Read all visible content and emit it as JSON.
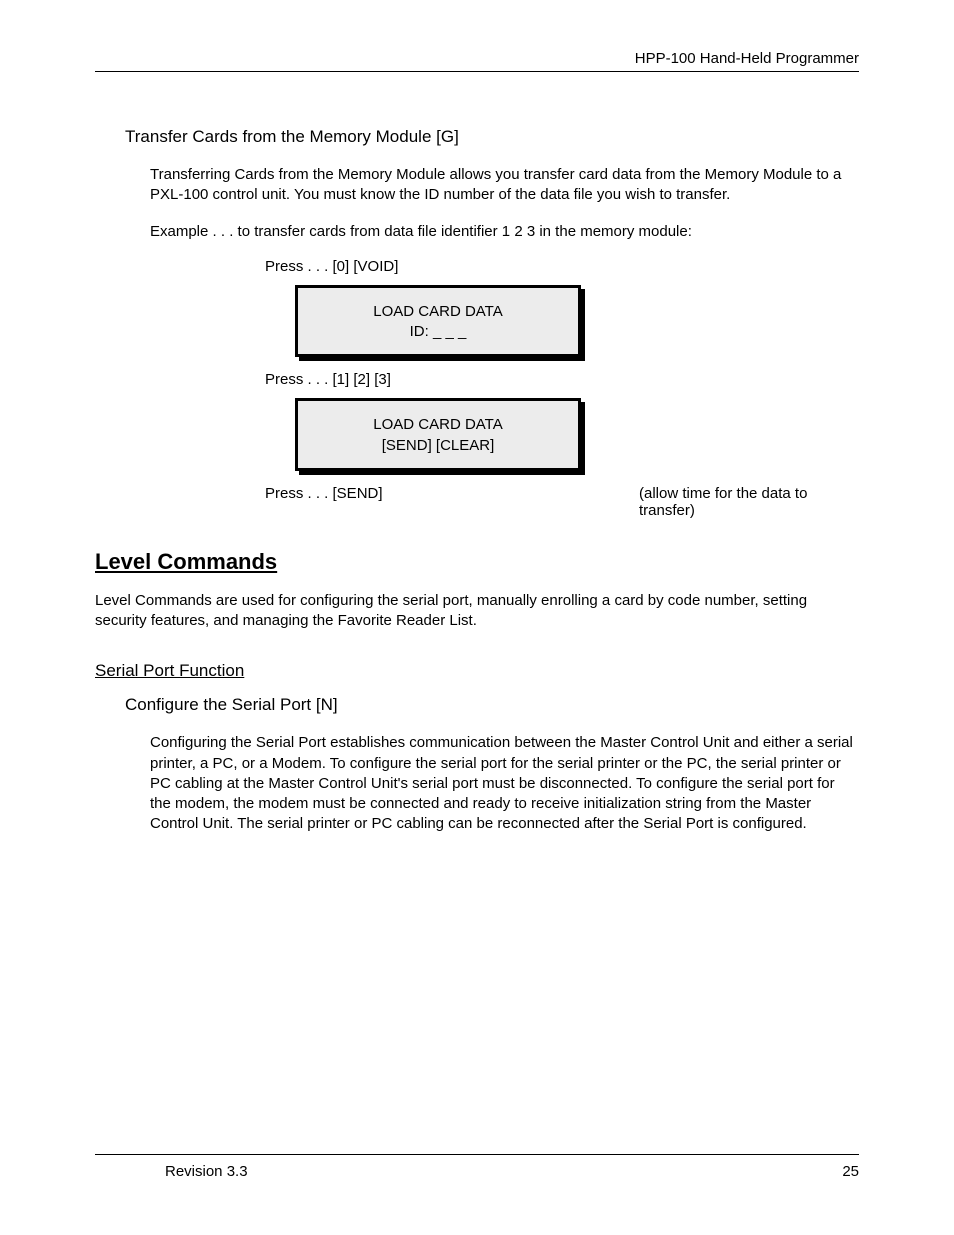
{
  "header": {
    "title": "HPP-100  Hand-Held Programmer"
  },
  "section1": {
    "title": "Transfer Cards from the Memory Module [G]",
    "para1": "Transferring Cards from the Memory Module allows you transfer card data from the Memory Module to a PXL-100 control unit. You must know the ID number of the data file you wish to transfer.",
    "para2": "Example . . . to transfer cards from data file identifier  1  2  3  in the memory module:",
    "press1": "Press . . . [0]     [VOID]",
    "lcd1_line1": "LOAD CARD DATA",
    "lcd1_line2": "ID:  _  _  _",
    "press2": "Press . . . [1]  [2]  [3]",
    "lcd2_line1": "LOAD CARD DATA",
    "lcd2_line2": "[SEND]     [CLEAR]",
    "press3_left": "Press . . . [SEND]",
    "press3_right": "(allow time for the data to transfer)"
  },
  "section2": {
    "h1": "Level Commands",
    "para1": "Level Commands are used for configuring the serial port, manually enrolling a card by code number, setting security features, and managing the Favorite Reader List.",
    "h2": "Serial Port Function",
    "sub": "Configure the Serial Port [N]",
    "para2": "Configuring the Serial Port establishes communication between the Master Control Unit and either a serial printer, a PC, or a Modem. To configure the serial port for the serial printer or the PC, the serial printer or PC cabling at the Master Control Unit's serial port must be disconnected. To configure the serial port for the modem, the modem must be connected and ready to receive initialization string from the Master Control Unit. The serial printer or PC cabling can be reconnected after the Serial Port is configured."
  },
  "footer": {
    "revision": "Revision 3.3",
    "page": "25"
  }
}
